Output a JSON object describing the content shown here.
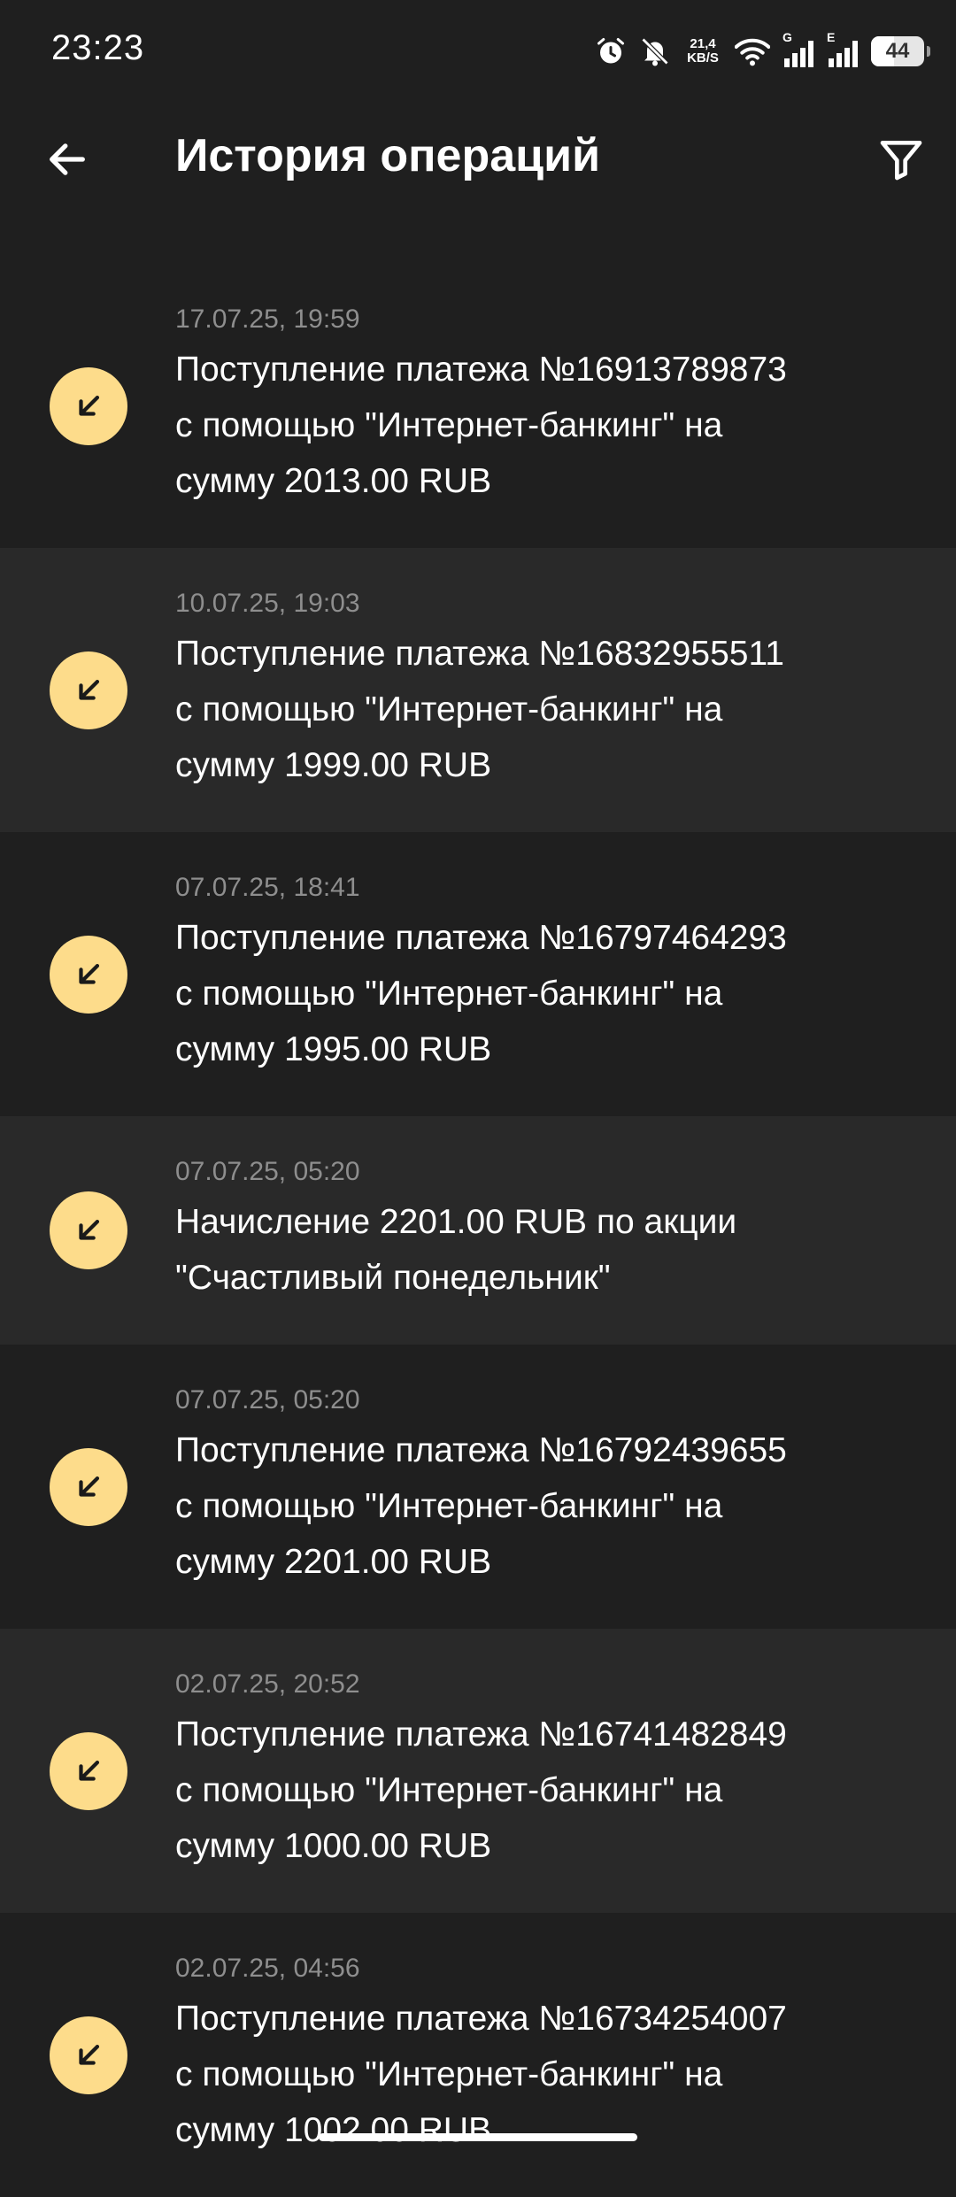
{
  "status_bar": {
    "time": "23:23",
    "net_speed_value": "21,4",
    "net_speed_unit": "KB/S",
    "signal_1_label": "G",
    "signal_2_label": "E",
    "battery_level": "44",
    "battery_fraction": 0.44
  },
  "header": {
    "title": "История операций",
    "back_icon": "arrow-left-icon",
    "filter_icon": "filter-funnel-icon"
  },
  "operations": [
    {
      "date": "17.07.25, 19:59",
      "text": "Поступление платежа №16913789873\nс помощью \"Интернет-банкинг\" на\nсумму 2013.00 RUB"
    },
    {
      "date": "10.07.25, 19:03",
      "text": "Поступление платежа №16832955511\nс помощью \"Интернет-банкинг\" на\nсумму 1999.00 RUB"
    },
    {
      "date": "07.07.25, 18:41",
      "text": "Поступление платежа №16797464293\nс помощью \"Интернет-банкинг\" на\nсумму 1995.00 RUB"
    },
    {
      "date": "07.07.25, 05:20",
      "text": "Начисление 2201.00 RUB по акции\n\"Счастливый понедельник\""
    },
    {
      "date": "07.07.25, 05:20",
      "text": "Поступление платежа №16792439655\nс помощью \"Интернет-банкинг\" на\nсумму 2201.00 RUB"
    },
    {
      "date": "02.07.25, 20:52",
      "text": "Поступление платежа №16741482849\nс помощью \"Интернет-банкинг\" на\nсумму 1000.00 RUB"
    },
    {
      "date": "02.07.25, 04:56",
      "text": "Поступление платежа №16734254007\nс помощью \"Интернет-банкинг\" на\nсумму 1002.00 RUB"
    }
  ],
  "colors": {
    "background": "#1f1f1f",
    "row_alt_background": "#292929",
    "icon_badge": "#fddc8b",
    "date_text": "#8e8e8e"
  },
  "row_icon": "incoming-arrow-icon"
}
